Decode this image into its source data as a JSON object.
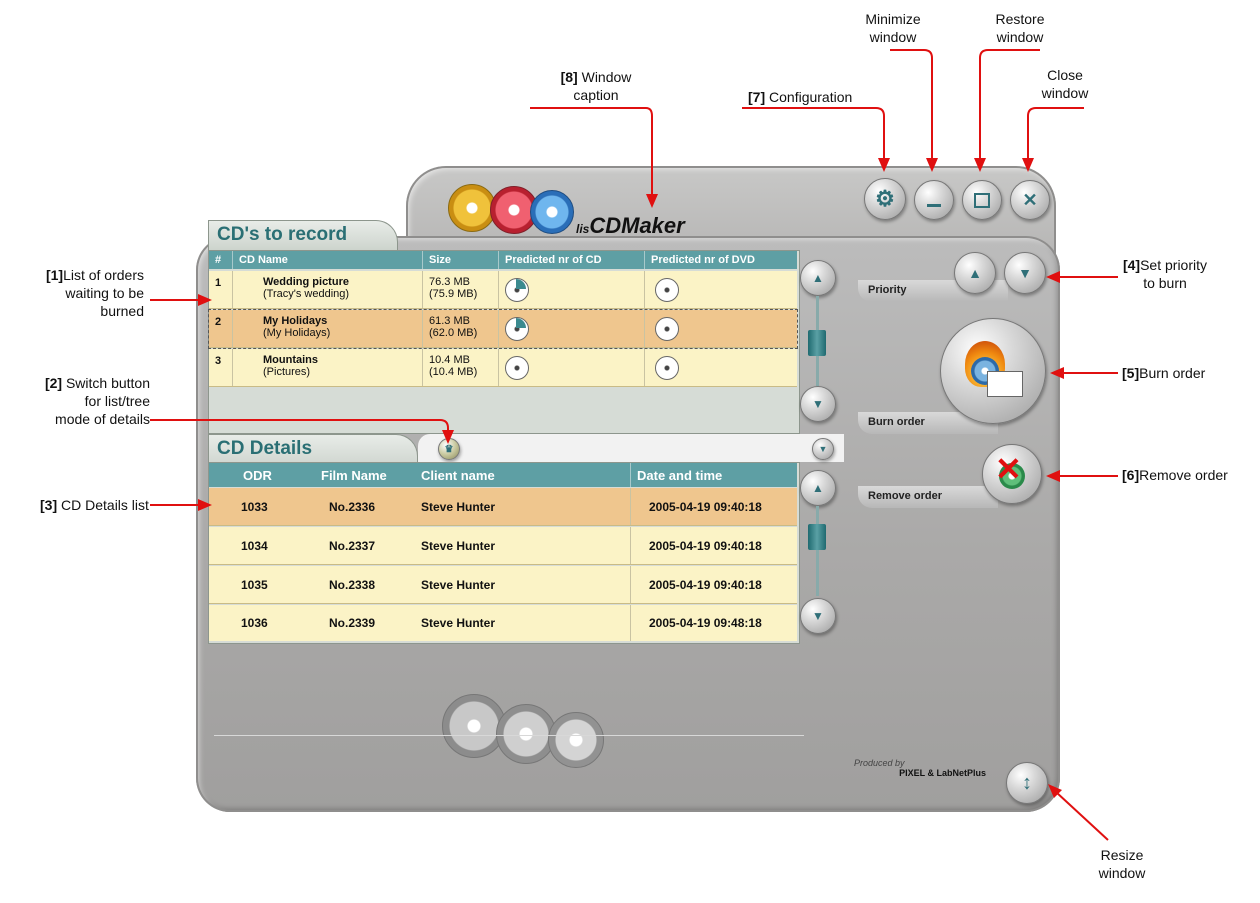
{
  "annotations": {
    "minimize": [
      "Minimize",
      "window"
    ],
    "restore": [
      "Restore",
      "window"
    ],
    "close": [
      "Close",
      "window"
    ],
    "window_caption": {
      "num": "[8]",
      "text1": " Window",
      "text2": "caption"
    },
    "configuration": {
      "num": "[7]",
      "text": " Configuration"
    },
    "list_orders": {
      "num": "[1]",
      "text1": "List of orders",
      "text2": "waiting to be",
      "text3": "burned"
    },
    "switch_button": {
      "num": "[2]",
      "text1": " Switch button",
      "text2": "for list/tree",
      "text3": "mode of details"
    },
    "cd_details_list": {
      "num": "[3]",
      "text": " CD Details list"
    },
    "set_priority": {
      "num": "[4]",
      "text1": "Set priority",
      "text2": "to burn"
    },
    "burn_order": {
      "num": "[5]",
      "text": "Burn order"
    },
    "remove_order": {
      "num": "[6]",
      "text": "Remove order"
    },
    "resize": [
      "Resize",
      "window"
    ]
  },
  "app": {
    "title_prefix": "lis",
    "title": "CDMaker",
    "credit_line1": "Produced by",
    "credit_line2": "PIXEL & LabNetPlus"
  },
  "record_panel": {
    "title": "CD's to record",
    "columns": [
      "#",
      "CD Name",
      "Size",
      "Predicted nr of CD",
      "Predicted nr of DVD"
    ],
    "rows": [
      {
        "num": "1",
        "name": "Wedding picture",
        "sub": "(Tracy's wedding)",
        "size": "76.3 MB",
        "size_sub": "(75.9 MB)"
      },
      {
        "num": "2",
        "name": "My Holidays",
        "sub": "(My Holidays)",
        "size": "61.3 MB",
        "size_sub": "(62.0 MB)"
      },
      {
        "num": "3",
        "name": "Mountains",
        "sub": "(Pictures)",
        "size": "10.4 MB",
        "size_sub": "(10.4 MB)"
      }
    ]
  },
  "details_panel": {
    "title": "CD Details",
    "columns": [
      "ODR",
      "Film Name",
      "Client name",
      "Date and time"
    ],
    "rows": [
      {
        "odr": "1033",
        "film": "No.2336",
        "client": "Steve Hunter",
        "date": "2005-04-19 09:40:18"
      },
      {
        "odr": "1034",
        "film": "No.2337",
        "client": "Steve Hunter",
        "date": "2005-04-19 09:40:18"
      },
      {
        "odr": "1035",
        "film": "No.2338",
        "client": "Steve Hunter",
        "date": "2005-04-19 09:40:18"
      },
      {
        "odr": "1036",
        "film": "No.2339",
        "client": "Steve Hunter",
        "date": "2005-04-19 09:48:18"
      }
    ]
  },
  "side": {
    "priority_label": "Priority",
    "burn_label": "Burn order",
    "remove_label": "Remove order"
  },
  "colors": {
    "accent_teal": "#5e9fa4",
    "row_yellow": "#fbf3c6",
    "row_selected": "#efc68e",
    "annotation_red": "#e01010"
  }
}
